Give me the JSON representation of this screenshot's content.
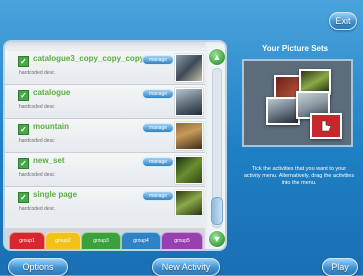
{
  "header": {
    "exit_label": "Exit"
  },
  "activities": [
    {
      "title": "catalogue3_copy_copy_copy",
      "subtitle": "hardcoded desc",
      "manage_label": "manage",
      "thumb_class": "thumb-a"
    },
    {
      "title": "catalogue",
      "subtitle": "hardcoded desc",
      "manage_label": "manage",
      "thumb_class": "thumb-b"
    },
    {
      "title": "mountain",
      "subtitle": "hardcoded desc",
      "manage_label": "manage",
      "thumb_class": "thumb-c"
    },
    {
      "title": "new_set",
      "subtitle": "hardcoded desc",
      "manage_label": "manage",
      "thumb_class": "thumb-d"
    },
    {
      "title": "single page",
      "subtitle": "hardcoded desc",
      "manage_label": "manage",
      "thumb_class": "thumb-e"
    }
  ],
  "tabs": [
    {
      "label": "group1",
      "color": "#d8262f"
    },
    {
      "label": "group2",
      "color": "#f0c21a"
    },
    {
      "label": "group3",
      "color": "#3aa13c"
    },
    {
      "label": "group4",
      "color": "#2f83c5"
    },
    {
      "label": "group5",
      "color": "#9a3fb0"
    }
  ],
  "right_panel": {
    "title": "Your Picture Sets",
    "hint": "Tick the activities that you want to your activity menu. Alternatively, drag the activities into the menu."
  },
  "footer": {
    "options_label": "Options",
    "new_activity_label": "New Activity",
    "play_label": "Play"
  },
  "colors": {
    "background": "#1f7fc4",
    "accent_green": "#5aae3f",
    "panel": "#e9edf0"
  }
}
